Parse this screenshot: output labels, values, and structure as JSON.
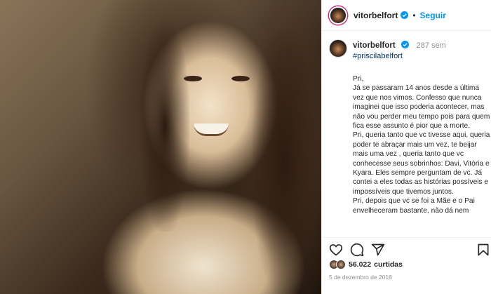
{
  "post": {
    "username": "vitorbelfort",
    "follow_label": "Seguir",
    "separator": "•",
    "caption_time": "287 sem",
    "hashtag": "#priscilabelfort",
    "caption_text": "Pri,\nJá se passaram 14 anos desde a última vez que nos vimos. Confesso que nunca imaginei que isso poderia acontecer, mas não vou perder meu tempo pois para quem fica esse assunto é pior que a morte.\nPri, queria tanto que vc tivesse aqui, queria poder te abraçar mais um vez, te beijar mais uma vez , queria tanto que vc conhecesse seus sobrinhos: Davi, Vitória e Kyara. Eles sempre perguntam de vc. Já contei a eles todas as histórias possíveis e impossíveis que tivemos juntos.\nPri, depois que vc se foi a Mãe e o Pai envelheceram bastante, não dá nem",
    "likes_count": "56.022",
    "likes_label": "curtidas",
    "date": "5 de dezembro de 2018"
  },
  "icons": {
    "verified": "verified-badge-icon",
    "like": "heart-icon",
    "comment": "comment-icon",
    "share": "share-icon",
    "save": "bookmark-icon"
  },
  "colors": {
    "accent": "#0095f6",
    "verified": "#0095f6",
    "hashtag": "#00376b",
    "muted": "#8e8e8e"
  }
}
